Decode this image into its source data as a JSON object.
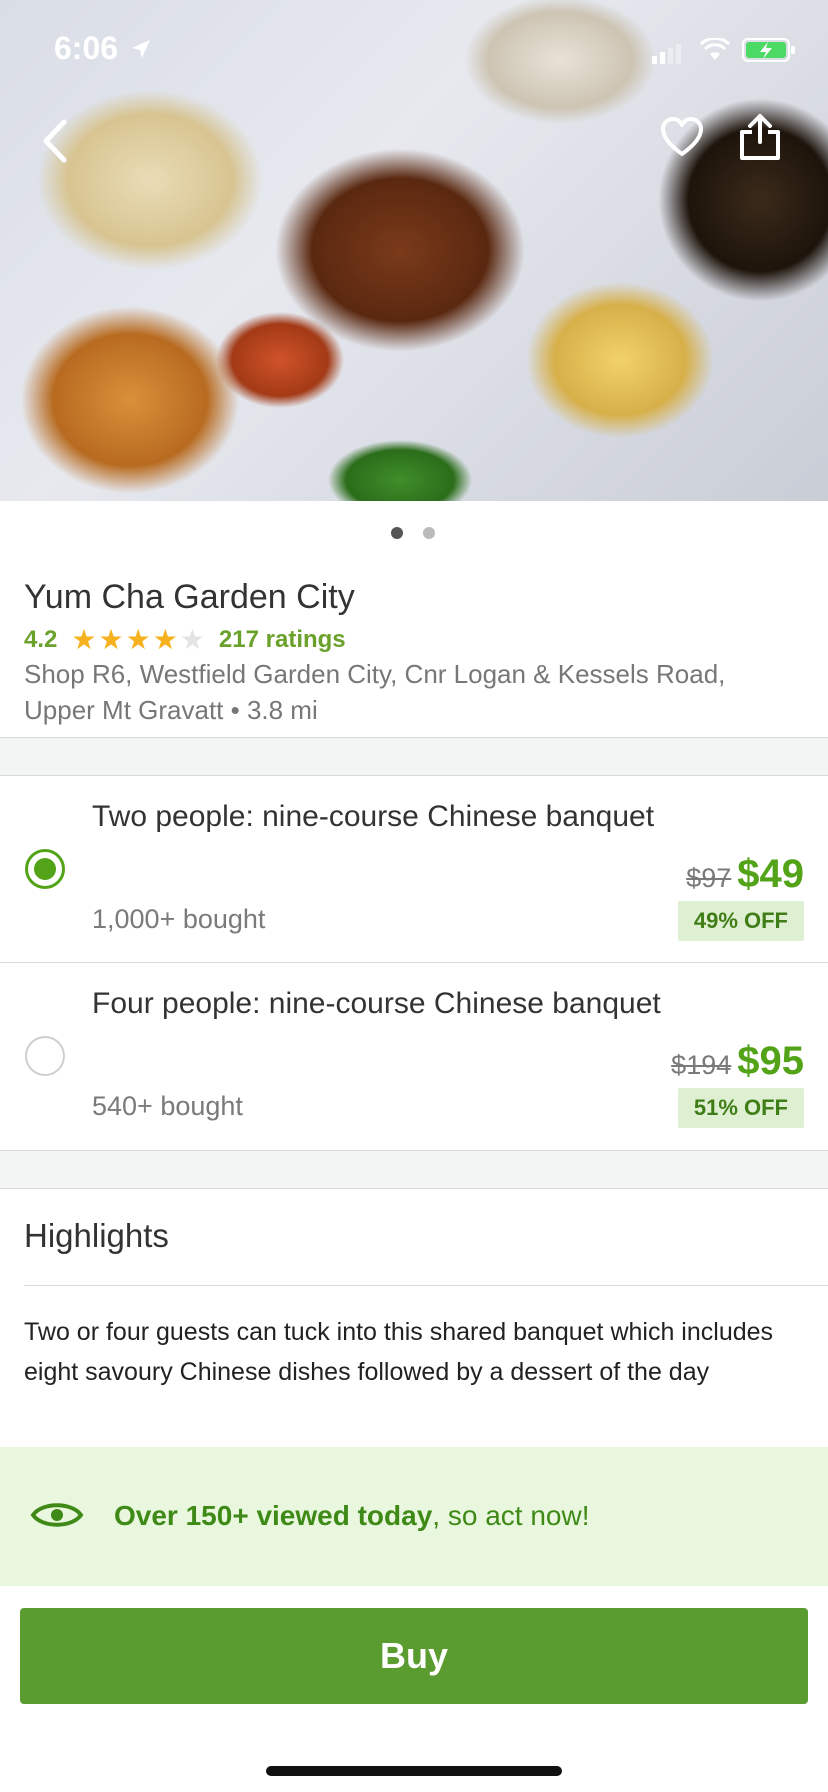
{
  "status_bar": {
    "time": "6:06"
  },
  "hero": {
    "icons": {
      "back": "chevron-left-icon",
      "favorite": "heart-icon",
      "share": "share-icon"
    },
    "carousel_pages": 2,
    "carousel_active": 1
  },
  "deal": {
    "title": "Yum Cha Garden City",
    "rating": "4.2",
    "stars_filled": 4,
    "stars_total": 5,
    "ratings_count": "217 ratings",
    "address_line1": "Shop R6,  Westfield Garden City,  Cnr Logan & Kessels Road,",
    "address_line2": "Upper Mt Gravatt • 3.8 mi"
  },
  "options": [
    {
      "title": "Two people: nine-course Chinese banquet",
      "bought": "1,000+ bought",
      "old_price": "$97",
      "new_price": "$49",
      "discount": "49% OFF",
      "selected": true
    },
    {
      "title": "Four people: nine-course Chinese banquet",
      "bought": "540+ bought",
      "old_price": "$194",
      "new_price": "$95",
      "discount": "51% OFF",
      "selected": false
    }
  ],
  "highlights": {
    "title": "Highlights",
    "text": "Two or four guests can tuck into this shared banquet which includes eight savoury Chinese dishes followed by a dessert of the day"
  },
  "urgency": {
    "strong": "Over 150+ viewed today",
    "rest": ", so act now!"
  },
  "buy_button": {
    "label": "Buy"
  },
  "colors": {
    "accent_green": "#53a318",
    "buy_green": "#5a9c2f",
    "rating_green": "#6aa12a",
    "star_gold": "#f5b21e",
    "urgency_bg": "#eaf7df"
  }
}
